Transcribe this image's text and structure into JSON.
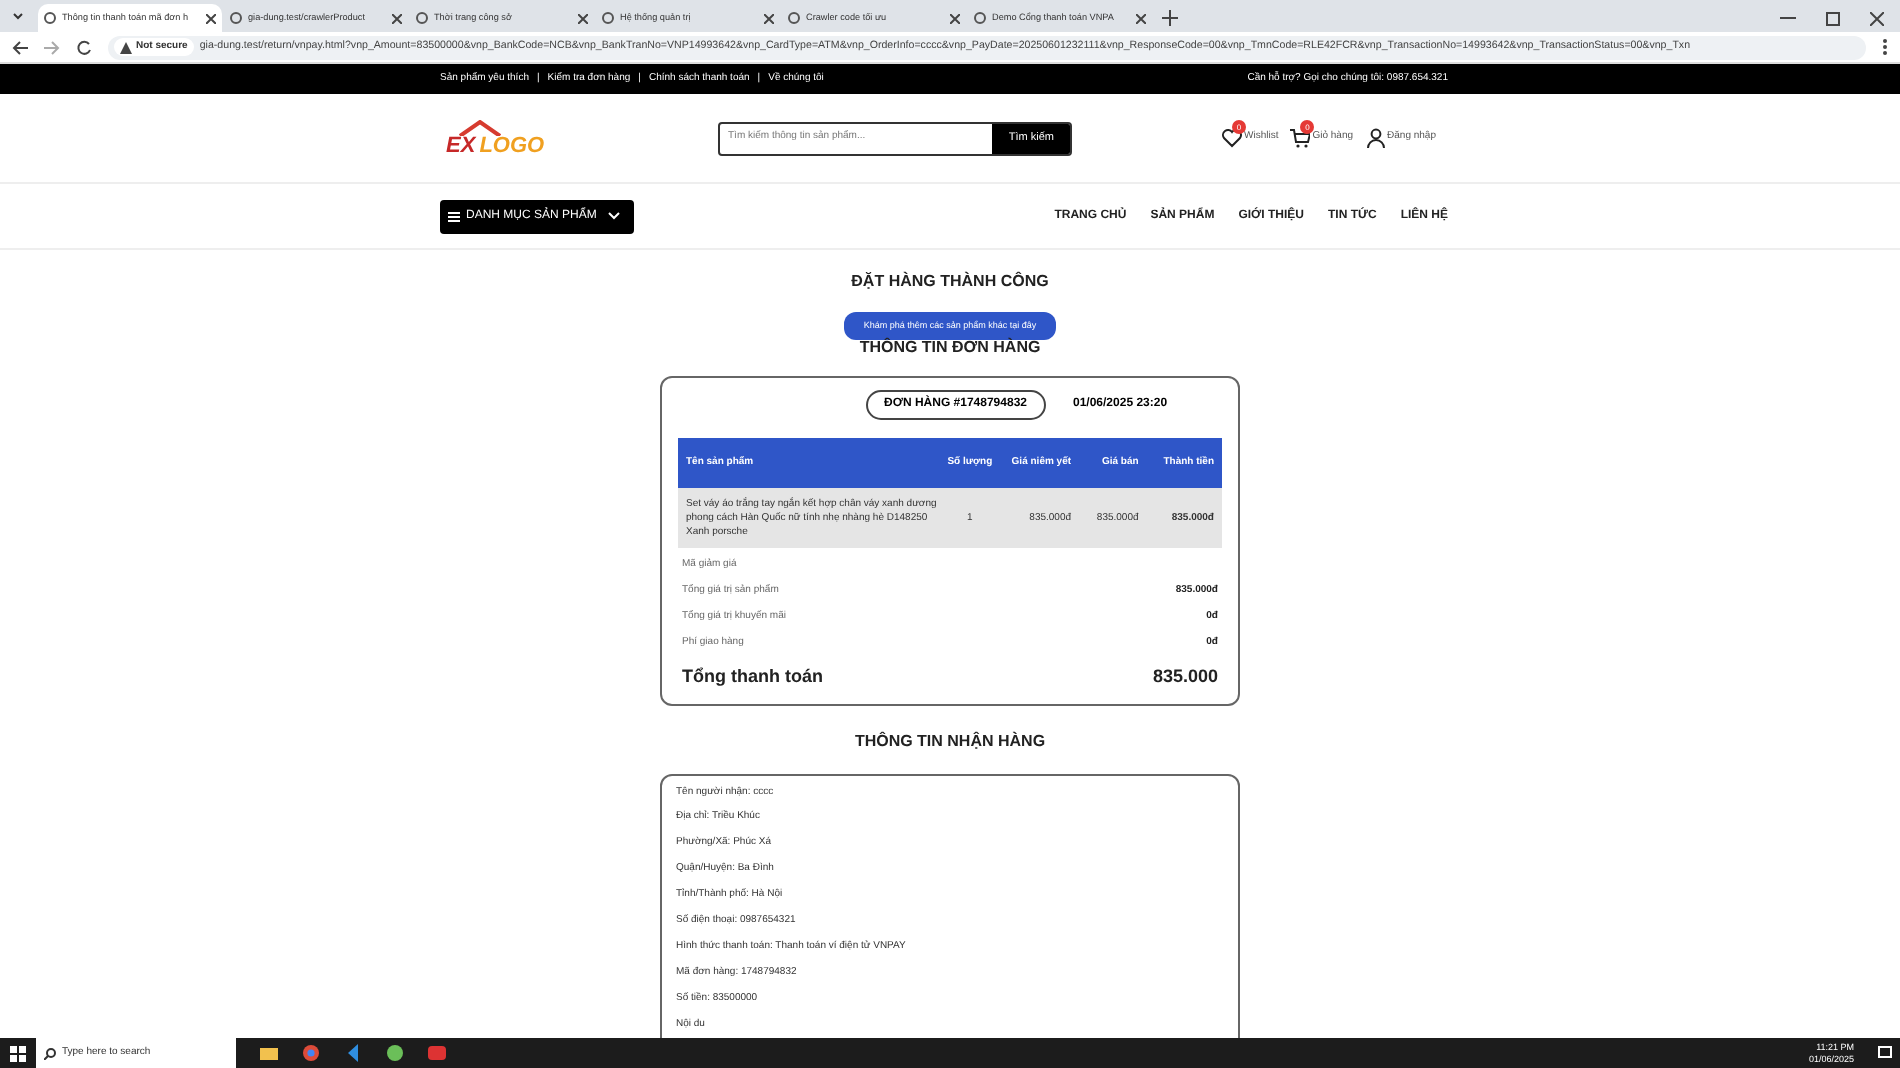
{
  "browser": {
    "tabs": [
      {
        "title": "Thông tin thanh toán mã đơn h",
        "selected": true
      },
      {
        "title": "gia-dung.test/crawlerProduct",
        "selected": false
      },
      {
        "title": "Thời trang công sở",
        "selected": false
      },
      {
        "title": "Hệ thống quản trị",
        "selected": false
      },
      {
        "title": "Crawler code tối ưu",
        "selected": false
      },
      {
        "title": "Demo Cổng thanh toán VNPA",
        "selected": false
      }
    ],
    "security": "Not secure",
    "url": "gia-dung.test/return/vnpay.html?vnp_Amount=83500000&vnp_BankCode=NCB&vnp_BankTranNo=VNP14993642&vnp_CardType=ATM&vnp_OrderInfo=cccc&vnp_PayDate=20250601232111&vnp_ResponseCode=00&vnp_TmnCode=RLE42FCR&vnp_TransactionNo=14993642&vnp_TransactionStatus=00&vnp_Txn"
  },
  "topbar": {
    "separators": [
      "|",
      "|",
      "|"
    ],
    "links": [
      "Sản phẩm yêu thích",
      "Kiểm tra đơn hàng",
      "Chính sách thanh toán",
      "Về chúng tôi"
    ],
    "hotline": "Cần hỗ trợ? Gọi cho chúng tôi: 0987.654.321"
  },
  "header": {
    "logo_ex": "EX",
    "logo_word": "LOGO",
    "search_placeholder": "Tìm kiếm thông tin sản phẩm...",
    "search_button": "Tìm kiếm",
    "wishlist": {
      "label": "Wishlist",
      "count": "0"
    },
    "cart": {
      "label": "Giỏ hàng",
      "count": "0"
    },
    "login": "Đăng nhập"
  },
  "nav": {
    "category_button": "DANH MỤC SẢN PHẨM",
    "links": [
      "TRANG CHỦ",
      "SẢN PHẨM",
      "GIỚI THIỆU",
      "TIN TỨC",
      "LIÊN HỆ"
    ]
  },
  "success_title": "ĐẶT HÀNG THÀNH CÔNG",
  "explore_button": "Khám phá thêm các sản phẩm khác tại đây",
  "order_title": "THÔNG TIN ĐƠN HÀNG",
  "order": {
    "number": "ĐƠN HÀNG #1748794832",
    "date": "01/06/2025 23:20",
    "columns": [
      "Tên sản phẩm",
      "Số lượng",
      "Giá niêm yết",
      "Giá bán",
      "Thành tiền"
    ],
    "rows": [
      [
        "Set váy áo trắng tay ngắn kết hợp chân váy xanh dương phong cách Hàn Quốc nữ tính nhẹ nhàng hè D148250 Xanh porsche",
        "1",
        "835.000đ",
        "835.000đ",
        "835.000đ"
      ]
    ],
    "summary": [
      {
        "label": "Mã giảm giá"
      },
      {
        "label": "Tổng giá trị sản phẩm",
        "value": "835.000đ"
      },
      {
        "label": "Tổng giá trị khuyến mãi",
        "value": "0đ"
      },
      {
        "label": "Phí giao hàng",
        "value": "0đ"
      }
    ],
    "total_label": "Tổng thanh toán",
    "total_value": "835.000"
  },
  "receive_title": "THÔNG TIN NHẬN HÀNG",
  "receive_lines": [
    "Tên người nhận: cccc",
    "Địa chỉ: Triều Khúc",
    "Phường/Xã: Phúc Xá",
    "Quận/Huyện: Ba Đình",
    "Tỉnh/Thành phố: Hà Nội",
    "Số điện thoại: 0987654321",
    "Hình thức thanh toán: Thanh toán ví điện tử VNPAY",
    "Mã đơn hàng: 1748794832",
    "Số tiền: 83500000",
    "Nội du"
  ],
  "taskbar": {
    "search": "Type here to search",
    "time": "11:21 PM",
    "date": "01/06/2025"
  }
}
